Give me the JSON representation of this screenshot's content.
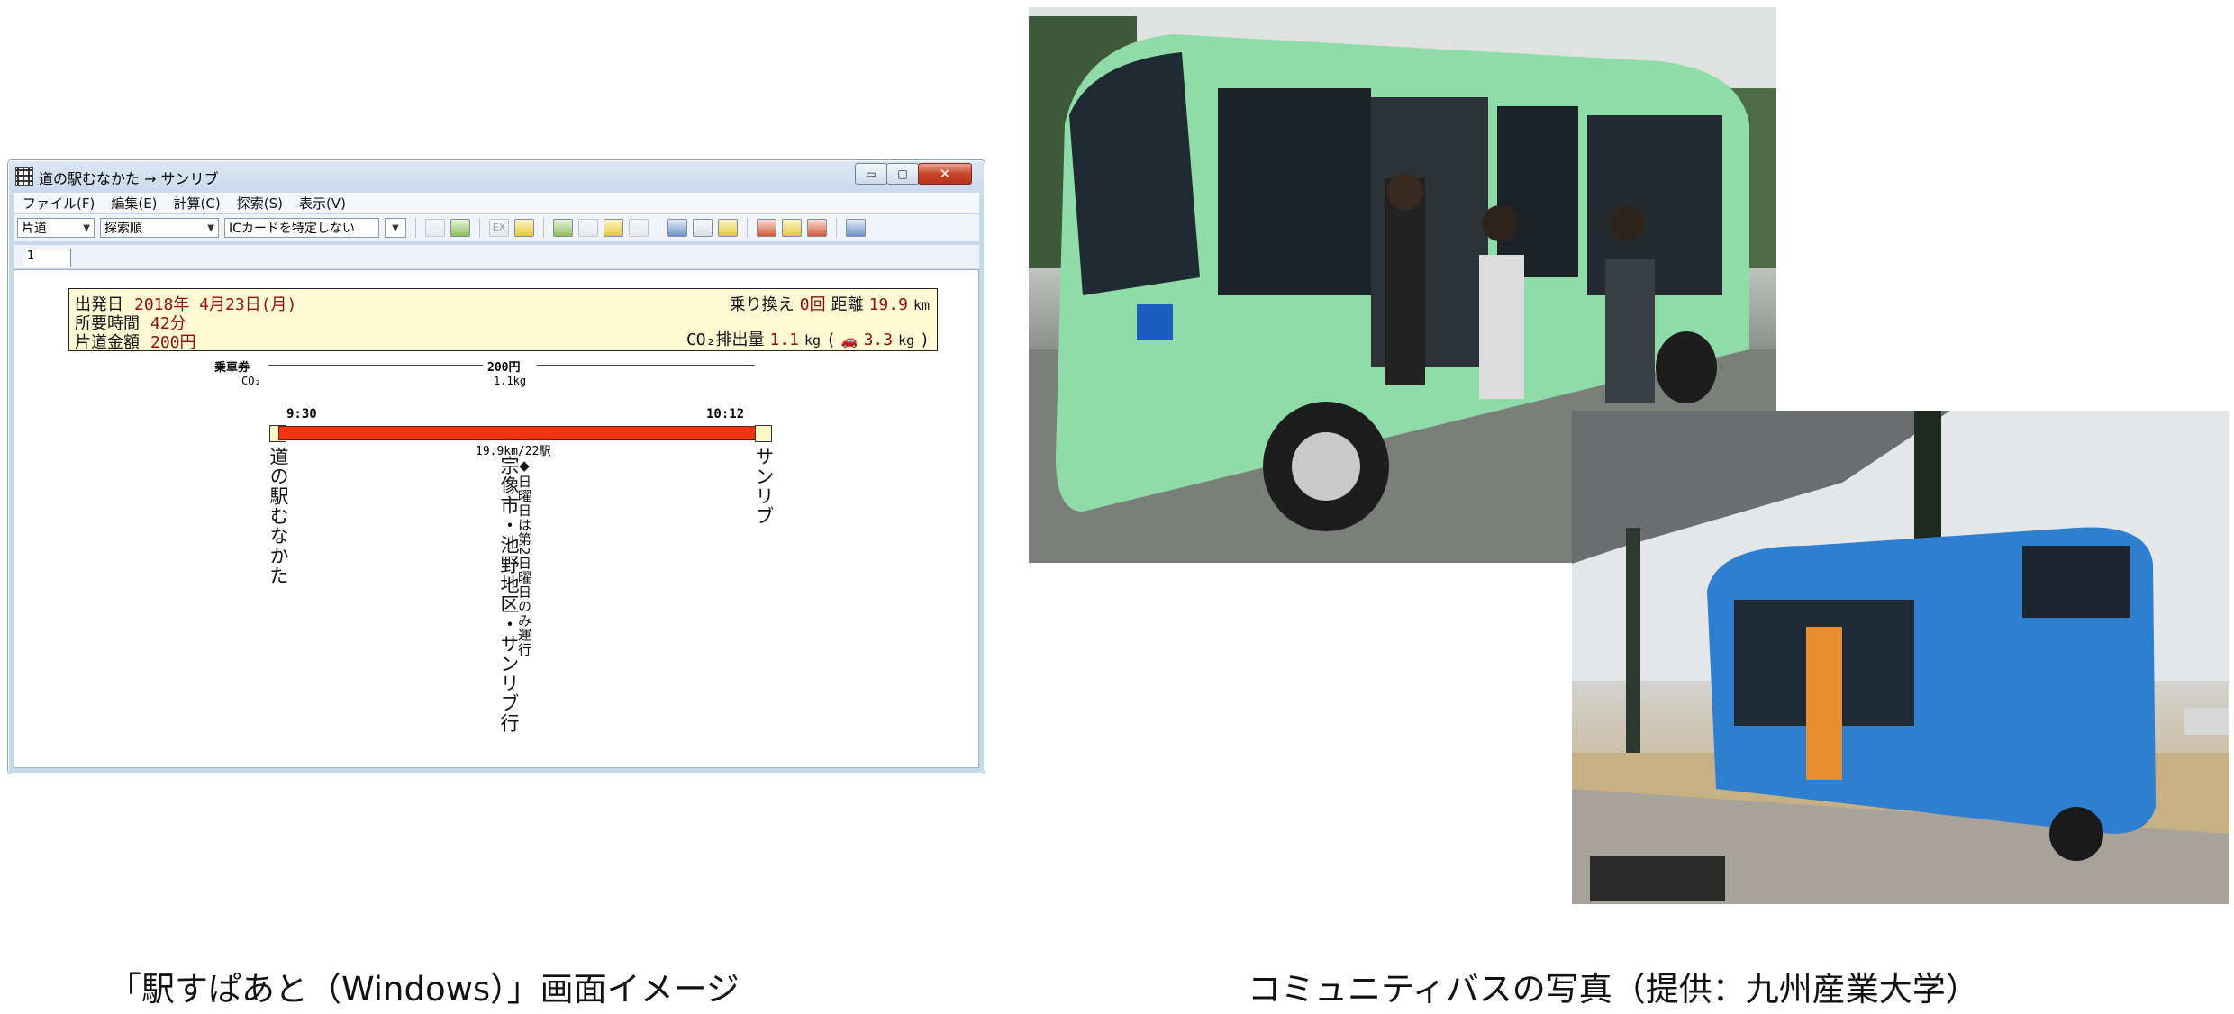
{
  "window": {
    "title": "道の駅むなかた → サンリブ",
    "controls": {
      "minimize": "▭",
      "maximize": "□",
      "close": "✕"
    }
  },
  "menu": [
    "ファイル(F)",
    "編集(E)",
    "計算(C)",
    "探索(S)",
    "表示(V)"
  ],
  "toolbar": {
    "trip_type": "片道",
    "sort_order": "探索順",
    "ic_card": "ICカードを特定しない",
    "ex_label": "EX"
  },
  "tab": "1",
  "summary": {
    "departure_label": "出発日",
    "departure_value": "2018年 4月23日(月)",
    "duration_label": "所要時間",
    "duration_value": "42分",
    "fare_label": "片道金額",
    "fare_value": "200円",
    "transfer_label": "乗り換え",
    "transfer_value": "0回",
    "distance_label": "距離",
    "distance_value": "19.9",
    "distance_unit": "km",
    "co2_label": "CO₂排出量",
    "co2_value": "1.1",
    "co2_unit": "kg",
    "co2_car_value": "3.3",
    "co2_car_unit": "kg"
  },
  "route": {
    "ticket_label": "乗車券",
    "fare": "200円",
    "co2_label": "CO₂",
    "co2_value": "1.1kg",
    "dep_time": "9:30",
    "arr_time": "10:12",
    "distance_stops": "19.9km/22駅",
    "origin": "道の駅むなかた",
    "line_name": "宗像市・池野地区・サンリブ行",
    "line_note": "◆日曜日は第2日曜日のみ運行",
    "destination": "サンリブ"
  },
  "captions": {
    "left": "「駅すぱあと（Windows）」画面イメージ",
    "right": "コミュニティバスの写真（提供：九州産業大学）"
  },
  "colors": {
    "route_bar": "#f03414",
    "summary_bg": "#fff9d4",
    "bus_green": "#8fdca8",
    "bus_blue": "#2f7fd0"
  }
}
